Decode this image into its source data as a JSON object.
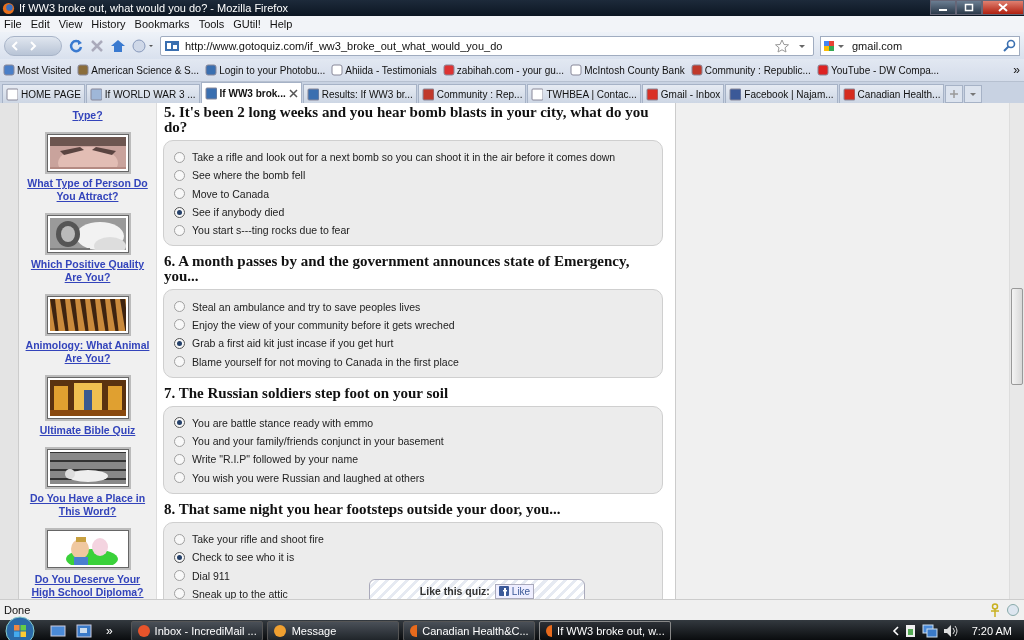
{
  "window": {
    "title": "If WW3 broke out, what would you do? - Mozilla Firefox"
  },
  "menu": [
    "File",
    "Edit",
    "View",
    "History",
    "Bookmarks",
    "Tools",
    "GUtil!",
    "Help"
  ],
  "address": {
    "url": "http://www.gotoquiz.com/if_ww3_broke_out_what_would_you_do"
  },
  "search": {
    "value": "gmail.com"
  },
  "bookmarks": [
    "Most Visited",
    "American Science & S...",
    "Login to your Photobu...",
    "Ahiida - Testimonials",
    "zabihah.com - your gu...",
    "McIntosh County Bank",
    "Community : Republic...",
    "YouTube - DW Compa..."
  ],
  "bookmarks_more": "»",
  "tabs": [
    {
      "label": "HOME PAGE",
      "selected": false
    },
    {
      "label": "If WORLD WAR 3 ...",
      "selected": false
    },
    {
      "label": "If WW3 brok...",
      "selected": true
    },
    {
      "label": "Results: If WW3 br...",
      "selected": false
    },
    {
      "label": "Community : Rep...",
      "selected": false
    },
    {
      "label": "TWHBEA | Contac...",
      "selected": false
    },
    {
      "label": "Gmail - Inbox",
      "selected": false
    },
    {
      "label": "Facebook | Najam...",
      "selected": false
    },
    {
      "label": "Canadian Health...",
      "selected": false
    }
  ],
  "sidebar": {
    "top_link": "Type?",
    "items": [
      {
        "label": "What Type of Person Do You Attract?"
      },
      {
        "label": "Which Positive Quality Are You?"
      },
      {
        "label": "Animology: What Animal Are You?"
      },
      {
        "label": "Ultimate Bible Quiz"
      },
      {
        "label": "Do You Have a Place in This Word?"
      },
      {
        "label": "Do You Deserve Your High School Diploma?"
      }
    ]
  },
  "questions": [
    {
      "text": "5. It's been 2 long weeks and you hear bomb blasts in your city, what do you do?",
      "options": [
        {
          "label": "Take a rifle and look out for a next bomb so you can shoot it in the air before it comes down",
          "selected": false
        },
        {
          "label": "See where the bomb fell",
          "selected": false
        },
        {
          "label": "Move to Canada",
          "selected": false
        },
        {
          "label": "See if anybody died",
          "selected": true
        },
        {
          "label": "You start s---ting rocks due to fear",
          "selected": false
        }
      ]
    },
    {
      "text": "6. A month passes by and the government announces state of Emergency, you...",
      "options": [
        {
          "label": "Steal an ambulance and try to save peoples lives",
          "selected": false
        },
        {
          "label": "Enjoy the view of your community before it gets wreched",
          "selected": false
        },
        {
          "label": "Grab a first aid kit just incase if you get hurt",
          "selected": true
        },
        {
          "label": "Blame yourself for not moving to Canada in the first place",
          "selected": false
        }
      ]
    },
    {
      "text": "7. The Russian soldiers step foot on your soil",
      "options": [
        {
          "label": "You are battle stance ready with emmo",
          "selected": true
        },
        {
          "label": "You and your family/friends conjunct in your basement",
          "selected": false
        },
        {
          "label": "Write \"R.I.P\" followed by your name",
          "selected": false
        },
        {
          "label": "You wish you were Russian and laughed at others",
          "selected": false
        }
      ]
    },
    {
      "text": "8. That same night you hear footsteps outside your door, you...",
      "options": [
        {
          "label": "Take your rifle and shoot fire",
          "selected": false
        },
        {
          "label": "Check to see who it is",
          "selected": true
        },
        {
          "label": "Dial 911",
          "selected": false
        },
        {
          "label": "Sneak up to the attic",
          "selected": false
        }
      ]
    }
  ],
  "like": {
    "label": "Like this quiz:",
    "button": "Like"
  },
  "status": "Done",
  "taskbar": {
    "more": "»",
    "tasks": [
      {
        "label": "Inbox - IncrediMail ...",
        "selected": false
      },
      {
        "label": "Message",
        "selected": false
      },
      {
        "label": "Canadian Health&C...",
        "selected": false
      },
      {
        "label": "If WW3 broke out, w...",
        "selected": true
      }
    ],
    "time": "7:20 AM"
  }
}
